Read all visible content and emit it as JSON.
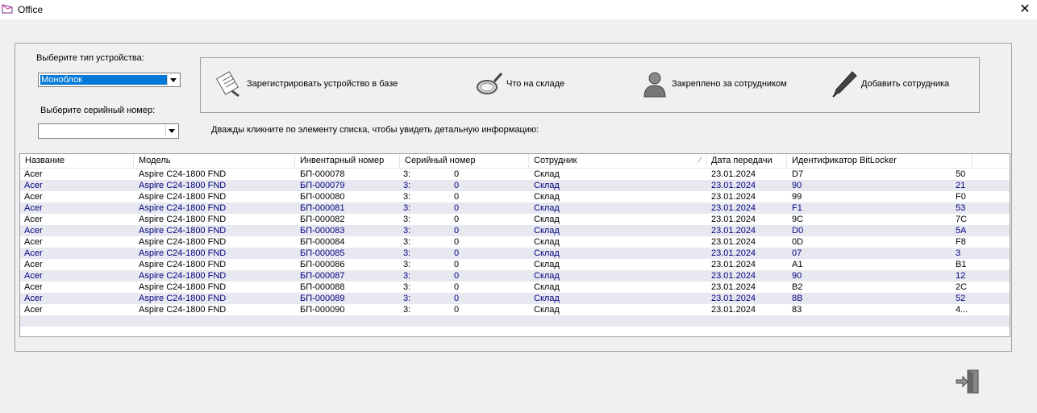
{
  "window": {
    "title": "Office"
  },
  "filters": {
    "device_type_label": "Выберите тип устройства:",
    "device_type_value": "Моноблок",
    "serial_label": "Выберите серийный номер:",
    "serial_value": ""
  },
  "toolbar": {
    "register_label": "Зарегистрировать устройство в базе",
    "stock_label": "Что на складе",
    "assigned_label": "Закреплено за сотрудником",
    "add_employee_label": "Добавить сотрудника"
  },
  "hint": "Дважды кликните по элементу списка, чтобы увидеть детальную информацию:",
  "table": {
    "columns": [
      "Название",
      "Модель",
      "Инвентарный номер",
      "Серийный номер",
      "Сотрудник",
      "Дата передачи",
      "Идентификатор BitLocker"
    ],
    "rows": [
      [
        "Acer",
        "Aspire C24-1800 FND",
        "БП-000078",
        "3:",
        "0",
        "Склад",
        "23.01.2024",
        "D7",
        "50"
      ],
      [
        "Acer",
        "Aspire C24-1800 FND",
        "БП-000079",
        "3:",
        "0",
        "Склад",
        "23.01.2024",
        "90",
        "21"
      ],
      [
        "Acer",
        "Aspire C24-1800 FND",
        "БП-000080",
        "3:",
        "0",
        "Склад",
        "23.01.2024",
        "99",
        "F0"
      ],
      [
        "Acer",
        "Aspire C24-1800 FND",
        "БП-000081",
        "3:",
        "0",
        "Склад",
        "23.01.2024",
        "F1",
        "53"
      ],
      [
        "Acer",
        "Aspire C24-1800 FND",
        "БП-000082",
        "3:",
        "0",
        "Склад",
        "23.01.2024",
        "9C",
        "7C"
      ],
      [
        "Acer",
        "Aspire C24-1800 FND",
        "БП-000083",
        "3:",
        "0",
        "Склад",
        "23.01.2024",
        "D0",
        "5A"
      ],
      [
        "Acer",
        "Aspire C24-1800 FND",
        "БП-000084",
        "3:",
        "0",
        "Склад",
        "23.01.2024",
        "0D",
        "F8"
      ],
      [
        "Acer",
        "Aspire C24-1800 FND",
        "БП-000085",
        "3:",
        "0",
        "Склад",
        "23.01.2024",
        "07",
        "3"
      ],
      [
        "Acer",
        "Aspire C24-1800 FND",
        "БП-000086",
        "3:",
        "0",
        "Склад",
        "23.01.2024",
        "A1",
        "B1"
      ],
      [
        "Acer",
        "Aspire C24-1800 FND",
        "БП-000087",
        "3:",
        "0",
        "Склад",
        "23.01.2024",
        "90",
        "12"
      ],
      [
        "Acer",
        "Aspire C24-1800 FND",
        "БП-000088",
        "3:",
        "0",
        "Склад",
        "23.01.2024",
        "B2",
        "2C"
      ],
      [
        "Acer",
        "Aspire C24-1800 FND",
        "БП-000089",
        "3:",
        "0",
        "Склад",
        "23.01.2024",
        "8B",
        "52"
      ],
      [
        "Acer",
        "Aspire C24-1800 FND",
        "БП-000090",
        "3:",
        "0",
        "Склад",
        "23.01.2024",
        "83",
        "4..."
      ]
    ]
  },
  "colors": {
    "row_text_alt": "#000080",
    "selection": "#0078d7"
  }
}
